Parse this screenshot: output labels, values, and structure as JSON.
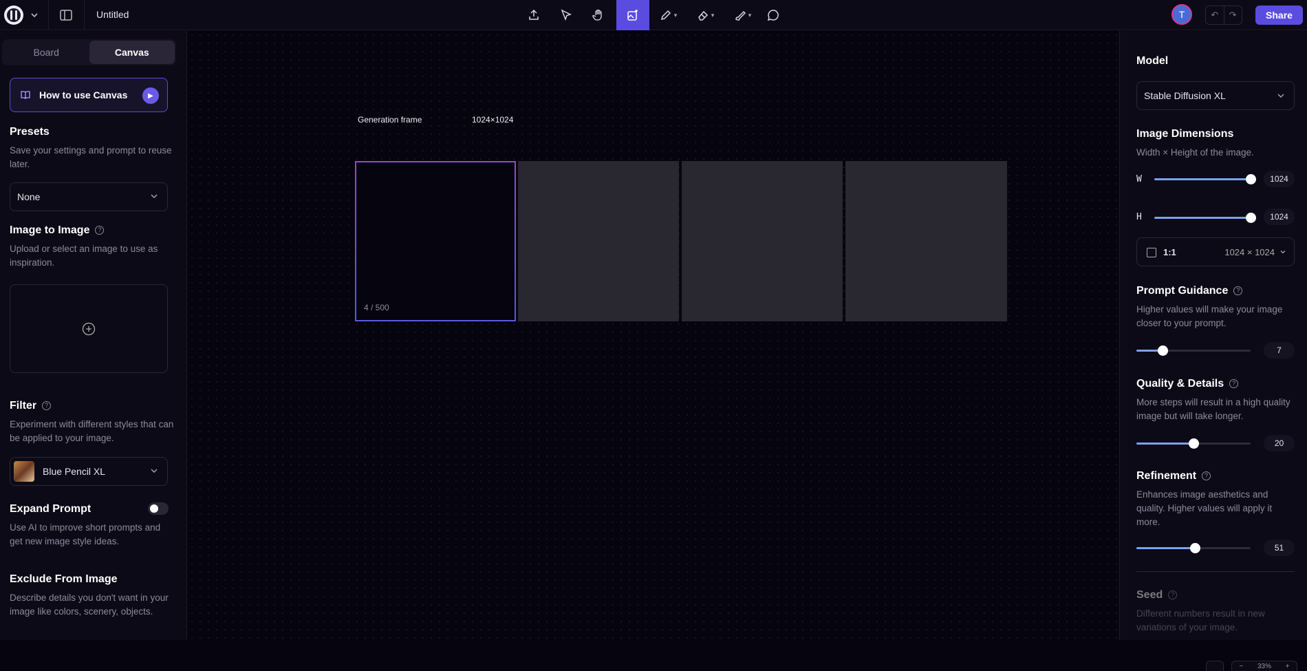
{
  "header": {
    "title": "Untitled",
    "avatar_initial": "T",
    "share_label": "Share",
    "tools": [
      "upload-icon",
      "select-icon",
      "hand-icon",
      "image-generate-icon",
      "pencil-icon",
      "eraser-icon",
      "brush-icon",
      "comment-icon"
    ]
  },
  "left": {
    "tabs": [
      "Board",
      "Canvas"
    ],
    "howto": "How to use Canvas",
    "presets": {
      "title": "Presets",
      "desc": "Save your settings and prompt to reuse later.",
      "value": "None"
    },
    "img2img": {
      "title": "Image to Image",
      "desc": "Upload or select an image to use as inspiration."
    },
    "filter": {
      "title": "Filter",
      "desc": "Experiment with different styles that can be applied to your image.",
      "value": "Blue Pencil XL"
    },
    "expand": {
      "title": "Expand Prompt",
      "desc": "Use AI to improve short prompts and get new image style ideas."
    },
    "exclude": {
      "title": "Exclude From Image",
      "desc": "Describe details you don't want in your image like colors, scenery, objects."
    }
  },
  "canvas": {
    "frame_label": "Generation frame",
    "frame_size": "1024×1024",
    "count": "4 / 500",
    "zoom": "33%"
  },
  "right": {
    "model": {
      "title": "Model",
      "value": "Stable Diffusion XL"
    },
    "dims": {
      "title": "Image Dimensions",
      "desc": "Width × Height of the image.",
      "w_label": "W",
      "h_label": "H",
      "w": "1024",
      "h": "1024",
      "w_fraction": 1.0,
      "h_fraction": 1.0,
      "ratio": "1:1",
      "ratio_dims": "1024 × 1024"
    },
    "guidance": {
      "title": "Prompt Guidance",
      "desc": "Higher values will make your image closer to your prompt.",
      "value": "7",
      "fraction": 0.23
    },
    "quality": {
      "title": "Quality & Details",
      "desc": "More steps will result in a high quality image but will take longer.",
      "value": "20",
      "fraction": 0.5
    },
    "refine": {
      "title": "Refinement",
      "desc": "Enhances image aesthetics and quality. Higher values will apply it more.",
      "value": "51",
      "fraction": 0.51
    },
    "seed": {
      "title": "Seed",
      "desc": "Different numbers result in new variations of your image."
    }
  },
  "colors": {
    "accent": "#5b4ce0",
    "slider": "#7aa2f0",
    "bg": "#06040f"
  }
}
